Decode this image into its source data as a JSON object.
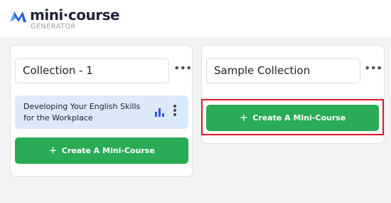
{
  "brand": {
    "title": "mini·course",
    "subtitle": "GENERATOR",
    "colors": {
      "logo_dark": "#2a5bd7",
      "logo_light": "#5aa3f0"
    }
  },
  "collections": [
    {
      "name": "Collection - 1",
      "menu_icon": "more-horizontal-icon",
      "courses": [
        {
          "title": "Developing Your English Skills for the Workplace",
          "stats_icon": "bar-chart-icon",
          "menu_icon": "more-vertical-icon"
        }
      ],
      "create_label": "Create A Mini-Course"
    },
    {
      "name": "Sample Collection",
      "menu_icon": "more-horizontal-icon",
      "courses": [],
      "create_label": "Create A Mini-Course"
    }
  ],
  "colors": {
    "accent": "#2aab55",
    "course_card": "#dbe9fa",
    "highlight": "#d51c2a"
  }
}
